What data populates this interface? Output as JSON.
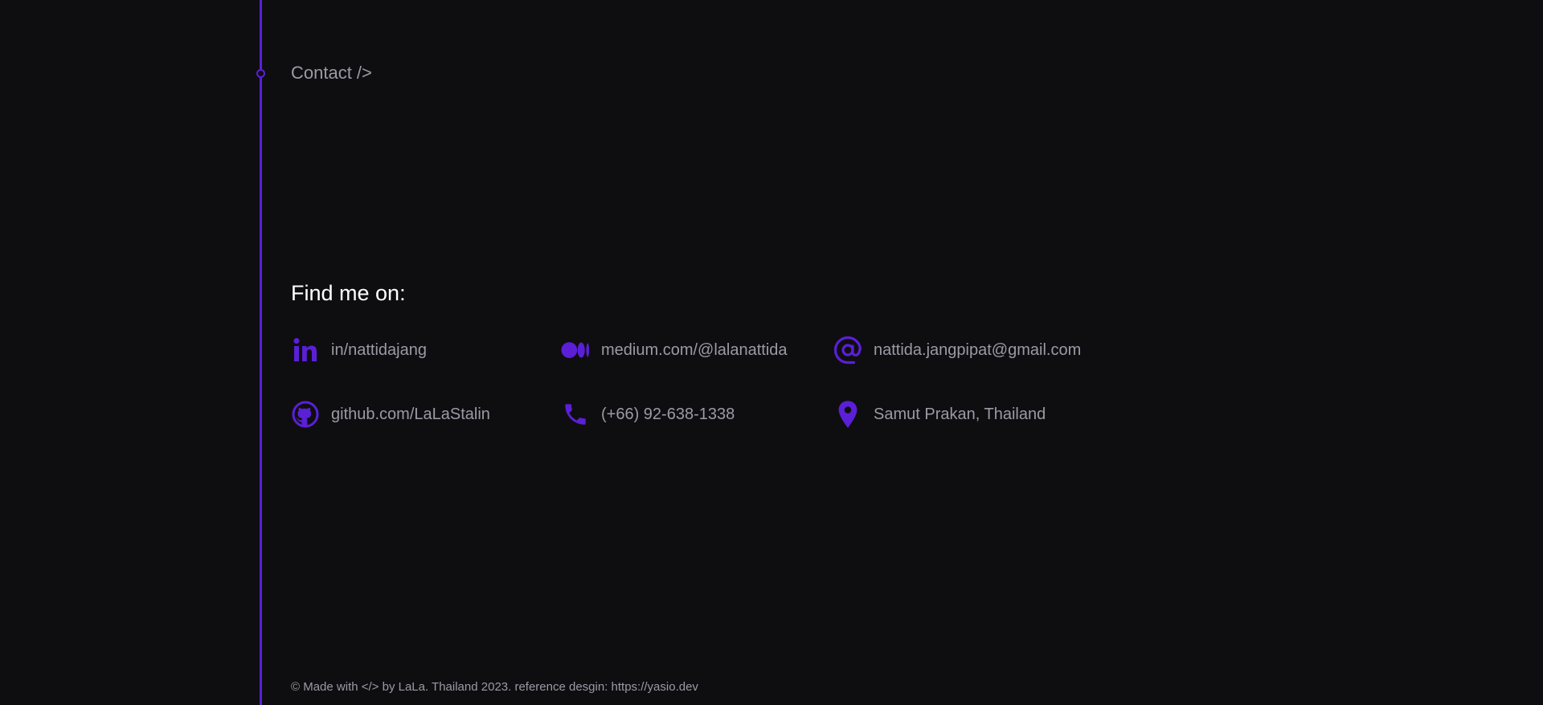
{
  "section": {
    "title": "Contact />"
  },
  "find_me": {
    "heading": "Find me on:",
    "items": [
      {
        "icon": "linkedin-icon",
        "label": "in/nattidajang"
      },
      {
        "icon": "medium-icon",
        "label": "medium.com/@lalanattida"
      },
      {
        "icon": "at-sign-icon",
        "label": "nattida.jangpipat@gmail.com"
      },
      {
        "icon": "github-icon",
        "label": "github.com/LaLaStalin"
      },
      {
        "icon": "phone-icon",
        "label": "(+66) 92-638-1338"
      },
      {
        "icon": "location-pin-icon",
        "label": "Samut Prakan, Thailand"
      }
    ]
  },
  "footer": {
    "text": "© Made with </> by LaLa. Thailand 2023. reference desgin: https://yasio.dev"
  },
  "colors": {
    "background": "#0e0e11",
    "accent": "#5b1fd6",
    "muted_text": "#9b9aa6",
    "heading_text": "#ffffff"
  }
}
